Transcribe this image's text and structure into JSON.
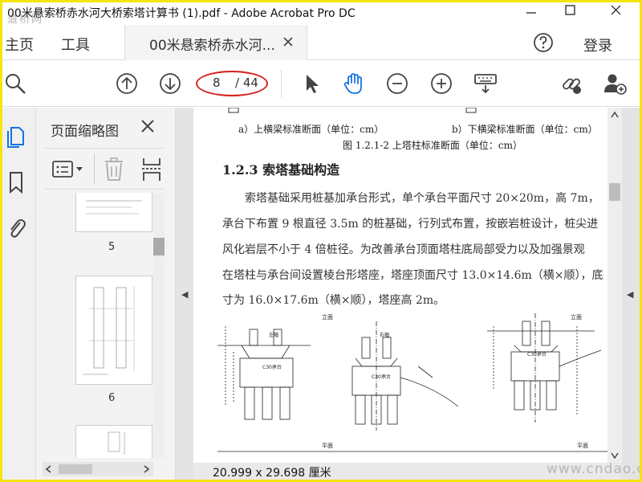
{
  "window": {
    "title": "00米悬索桥赤水河大桥索塔计算书 (1).pdf - Adobe Acrobat Pro DC",
    "watermark_logo": "道桥网"
  },
  "tabs": {
    "home": "主页",
    "tools": "工具",
    "document": "00米悬索桥赤水河..."
  },
  "header": {
    "login": "登录"
  },
  "toolbar": {
    "current_page": "8",
    "total_pages": "/ 44"
  },
  "panel": {
    "title": "页面缩略图",
    "thumbnails": [
      {
        "number": "5"
      },
      {
        "number": "6"
      }
    ]
  },
  "document": {
    "caption_a": "a）上横梁标准断面（单位：cm）",
    "caption_b": "b）下横梁标准断面（单位：cm）",
    "figure_caption": "图 1.2.1-2 上塔柱标准断面（单位：cm）",
    "section_heading": "1.2.3 索塔基础构造",
    "paragraph_lines": [
      "索塔基础采用桩基加承台形式，单个承台平面尺寸 20×20m，高 7m，",
      "承台下布置 9 根直径 3.5m 的桩基础，行列式布置，按嵌岩桩设计，桩尖进",
      "风化岩层不小于 4 倍桩径。为改善承台顶面塔柱底局部受力以及加强景观",
      "在塔柱与承台间设置棱台形塔座，塔座顶面尺寸 13.0×14.6m（横×顺），底",
      "寸为 16.0×17.6m（横×顺），塔座高 2m。"
    ],
    "drawing_labels": {
      "elev1": "立面",
      "elev2": "立面",
      "left": "左幅",
      "right": "右幅",
      "cap1": "C30承台",
      "cap2": "C30承台",
      "cap3": "C30承台",
      "plan1": "平面",
      "plan2": "平面"
    }
  },
  "status": {
    "page_size": "20.999 x 29.698 厘米",
    "site_watermark": "www.cndao.com"
  },
  "colors": {
    "frame": "#f5e50a",
    "annotation_ring": "#d9201f",
    "accent_blue": "#1473e6"
  }
}
